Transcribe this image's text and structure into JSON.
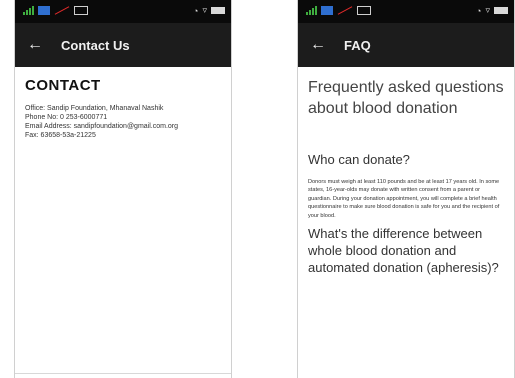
{
  "left_screen": {
    "status": {
      "right_text": "⚡"
    },
    "app_bar": {
      "back_icon": "arrow-left-icon",
      "title": "Contact Us"
    },
    "heading": "CONTACT",
    "lines": [
      "Office: Sandip Foundation, Mhanaval Nashik",
      "Phone No: 0 253-6000771",
      "Email Address: sandipfoundation@gmail.com.org",
      "Fax: 63658-53a-21225"
    ]
  },
  "right_screen": {
    "status": {
      "right_text": "⚡"
    },
    "app_bar": {
      "back_icon": "arrow-left-icon",
      "title": "FAQ"
    },
    "title": "Frequently asked questions about blood donation",
    "items": [
      {
        "question": "Who can donate?",
        "answer": "Donors must weigh at least 110 pounds and be at least 17 years old. In some states, 16-year-olds may donate with written consent from a parent or guardian. During your donation appointment, you will complete a brief health questionnaire to make sure blood donation is safe for you and the recipient of your blood."
      },
      {
        "question": "What's the difference between whole blood donation and automated donation (apheresis)?",
        "answer": ""
      }
    ]
  },
  "colors": {
    "status_bar": "#0a0a0a",
    "app_bar": "#1c1c1c",
    "signal_green": "#3fae3f",
    "signal_blue": "#2f6fd0"
  }
}
